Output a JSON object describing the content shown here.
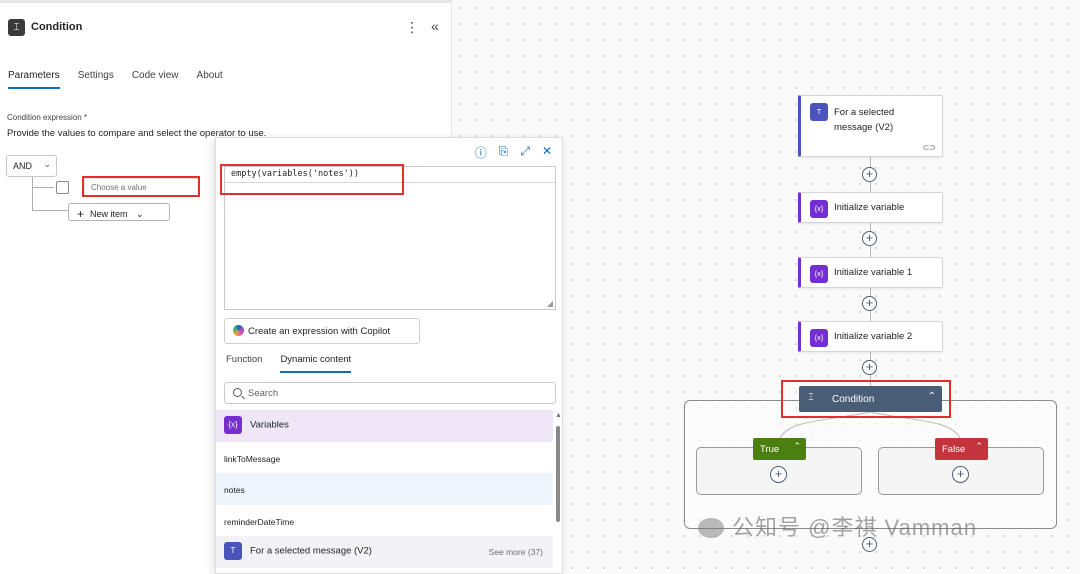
{
  "panel": {
    "title": "Condition",
    "icon": "condition-icon",
    "kebab": "⋮",
    "collapse": "«",
    "tabs": [
      {
        "label": "Parameters",
        "active": true
      },
      {
        "label": "Settings",
        "active": false
      },
      {
        "label": "Code view",
        "active": false
      },
      {
        "label": "About",
        "active": false
      }
    ],
    "condition_label": "Condition expression *",
    "condition_help": "Provide the values to compare and select the operator to use.",
    "operator": "AND",
    "value_placeholder": "Choose a value",
    "new_item_label": "New item"
  },
  "popup": {
    "expression": "empty(variables('notes'))",
    "copilot_button": "Create an expression with Copilot",
    "tabs": [
      {
        "label": "Function",
        "active": false
      },
      {
        "label": "Dynamic content",
        "active": true
      }
    ],
    "search_placeholder": "Search",
    "group_variables": "Variables",
    "var_icon_text": "{x}",
    "items": [
      "linkToMessage",
      "notes",
      "reminderDateTime"
    ],
    "group_trigger": "For a selected message (V2)",
    "see_more": "See more (37)"
  },
  "flow": {
    "trigger": {
      "line1": "For a selected",
      "line2": "message (V2)"
    },
    "steps": [
      "Initialize variable",
      "Initialize variable 1",
      "Initialize variable 2"
    ],
    "condition": "Condition",
    "true_label": "True",
    "false_label": "False"
  },
  "watermark": "公知号 @李祺 Vamman",
  "colors": {
    "accent": "#0f6cbd",
    "variable": "#742ed1",
    "condition": "#4a5d77",
    "true": "#4b7f12",
    "false": "#c3343c",
    "highlight": "#e0302a"
  }
}
